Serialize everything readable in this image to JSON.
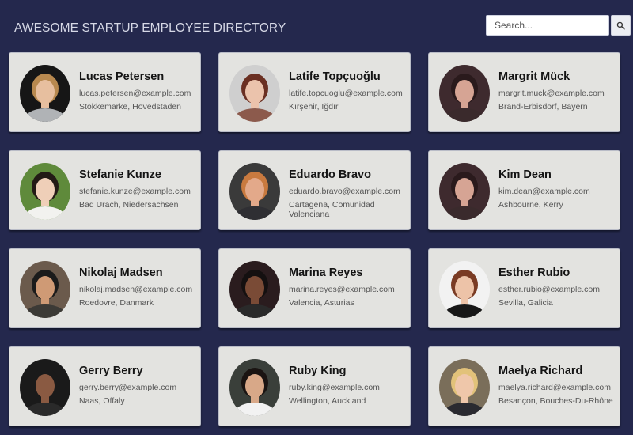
{
  "header": {
    "title": "AWESOME STARTUP EMPLOYEE DIRECTORY"
  },
  "search": {
    "placeholder": "Search...",
    "value": "",
    "button_icon": "search-icon"
  },
  "employees": [
    {
      "name": "Lucas Petersen",
      "email": "lucas.petersen@example.com",
      "location": "Stokkemarke, Hovedstaden",
      "photo": {
        "bg": "#161616",
        "hair": "#b8894f",
        "skin": "#e7bf9f",
        "shirt": "#b0b3b6"
      }
    },
    {
      "name": "Latife Topçuoğlu",
      "email": "latife.topcuoglu@example.com",
      "location": "Kırşehir, Iğdır",
      "photo": {
        "bg": "#cfcfcf",
        "hair": "#6a2f22",
        "skin": "#ebc3ac",
        "shirt": "#8c5a4c"
      }
    },
    {
      "name": "Margrit Mück",
      "email": "margrit.muck@example.com",
      "location": "Brand-Erbisdorf, Bayern",
      "photo": {
        "bg": "#3e2a2e",
        "hair": "#2a1a1c",
        "skin": "#d6a494",
        "shirt": "#3a2a2c"
      }
    },
    {
      "name": "Stefanie Kunze",
      "email": "stefanie.kunze@example.com",
      "location": "Bad Urach, Niedersachsen",
      "photo": {
        "bg": "#5f8a3b",
        "hair": "#231a16",
        "skin": "#efcfb8",
        "shirt": "#f2f2ef"
      }
    },
    {
      "name": "Eduardo Bravo",
      "email": "eduardo.bravo@example.com",
      "location": "Cartagena, Comunidad Valenciana",
      "photo": {
        "bg": "#3a3a3a",
        "hair": "#c97a3f",
        "skin": "#e3a98a",
        "shirt": "#2f2f33"
      }
    },
    {
      "name": "Kim Dean",
      "email": "kim.dean@example.com",
      "location": "Ashbourne, Kerry",
      "photo": {
        "bg": "#3e2a2e",
        "hair": "#2a1a1c",
        "skin": "#d6a494",
        "shirt": "#3a2a2c"
      }
    },
    {
      "name": "Nikolaj Madsen",
      "email": "nikolaj.madsen@example.com",
      "location": "Roedovre, Danmark",
      "photo": {
        "bg": "#6b5a4c",
        "hair": "#1b1b1b",
        "skin": "#cf9a75",
        "shirt": "#3c3a36"
      }
    },
    {
      "name": "Marina Reyes",
      "email": "marina.reyes@example.com",
      "location": "Valencia, Asturias",
      "photo": {
        "bg": "#2a1c1e",
        "hair": "#141010",
        "skin": "#7a4b36",
        "shirt": "#2a2a2a"
      }
    },
    {
      "name": "Esther Rubio",
      "email": "esther.rubio@example.com",
      "location": "Sevilla, Galicia",
      "photo": {
        "bg": "#f2f2f2",
        "hair": "#7a3b24",
        "skin": "#edc3a8",
        "shirt": "#171717"
      }
    },
    {
      "name": "Gerry Berry",
      "email": "gerry.berry@example.com",
      "location": "Naas, Offaly",
      "photo": {
        "bg": "#1a1a1a",
        "hair": "#1a1a1a",
        "skin": "#8a5a42",
        "shirt": "#2a2a2a"
      }
    },
    {
      "name": "Ruby King",
      "email": "ruby.king@example.com",
      "location": "Wellington, Auckland",
      "photo": {
        "bg": "#3a3f3a",
        "hair": "#1a1412",
        "skin": "#d8a888",
        "shirt": "#f2f2f2"
      }
    },
    {
      "name": "Maelya Richard",
      "email": "maelya.richard@example.com",
      "location": "Besançon, Bouches-Du-Rhône",
      "photo": {
        "bg": "#7a6e5a",
        "hair": "#e2c27a",
        "skin": "#efc7aa",
        "shirt": "#2a2a30"
      }
    }
  ]
}
